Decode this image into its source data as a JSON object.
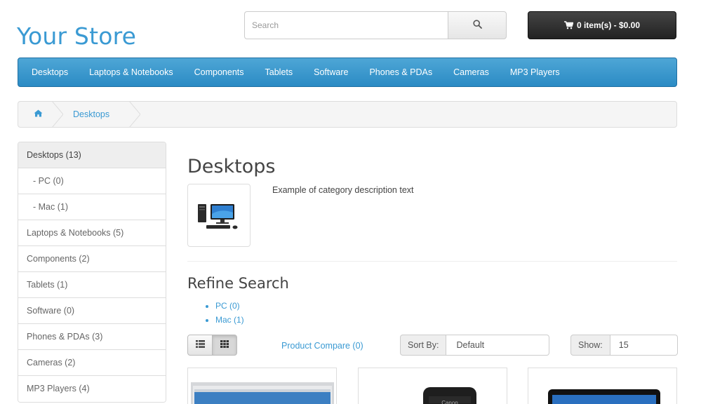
{
  "store": {
    "name": "Your Store"
  },
  "search": {
    "placeholder": "Search"
  },
  "cart": {
    "label": "0 item(s) - $0.00"
  },
  "menu": [
    "Desktops",
    "Laptops & Notebooks",
    "Components",
    "Tablets",
    "Software",
    "Phones & PDAs",
    "Cameras",
    "MP3 Players"
  ],
  "breadcrumb": {
    "current": "Desktops"
  },
  "sidebar": {
    "items": [
      "Desktops (13)",
      "- PC (0)",
      "- Mac (1)",
      "Laptops & Notebooks (5)",
      "Components (2)",
      "Tablets (1)",
      "Software (0)",
      "Phones & PDAs (3)",
      "Cameras (2)",
      "MP3 Players (4)"
    ]
  },
  "category": {
    "title": "Desktops",
    "description": "Example of category description text"
  },
  "refine": {
    "title": "Refine Search",
    "links": [
      "PC (0)",
      "Mac (1)"
    ]
  },
  "toolbar": {
    "compare_label": "Product Compare (0)",
    "sort_label": "Sort By:",
    "sort_value": "Default",
    "show_label": "Show:",
    "show_value": "15"
  },
  "colors": {
    "accent": "#3a9ad3",
    "menu_bar": "#2b8bc4",
    "cart_button": "#222222"
  },
  "icons": [
    "search-icon",
    "cart-icon",
    "home-icon",
    "list-view-icon",
    "grid-view-icon"
  ]
}
